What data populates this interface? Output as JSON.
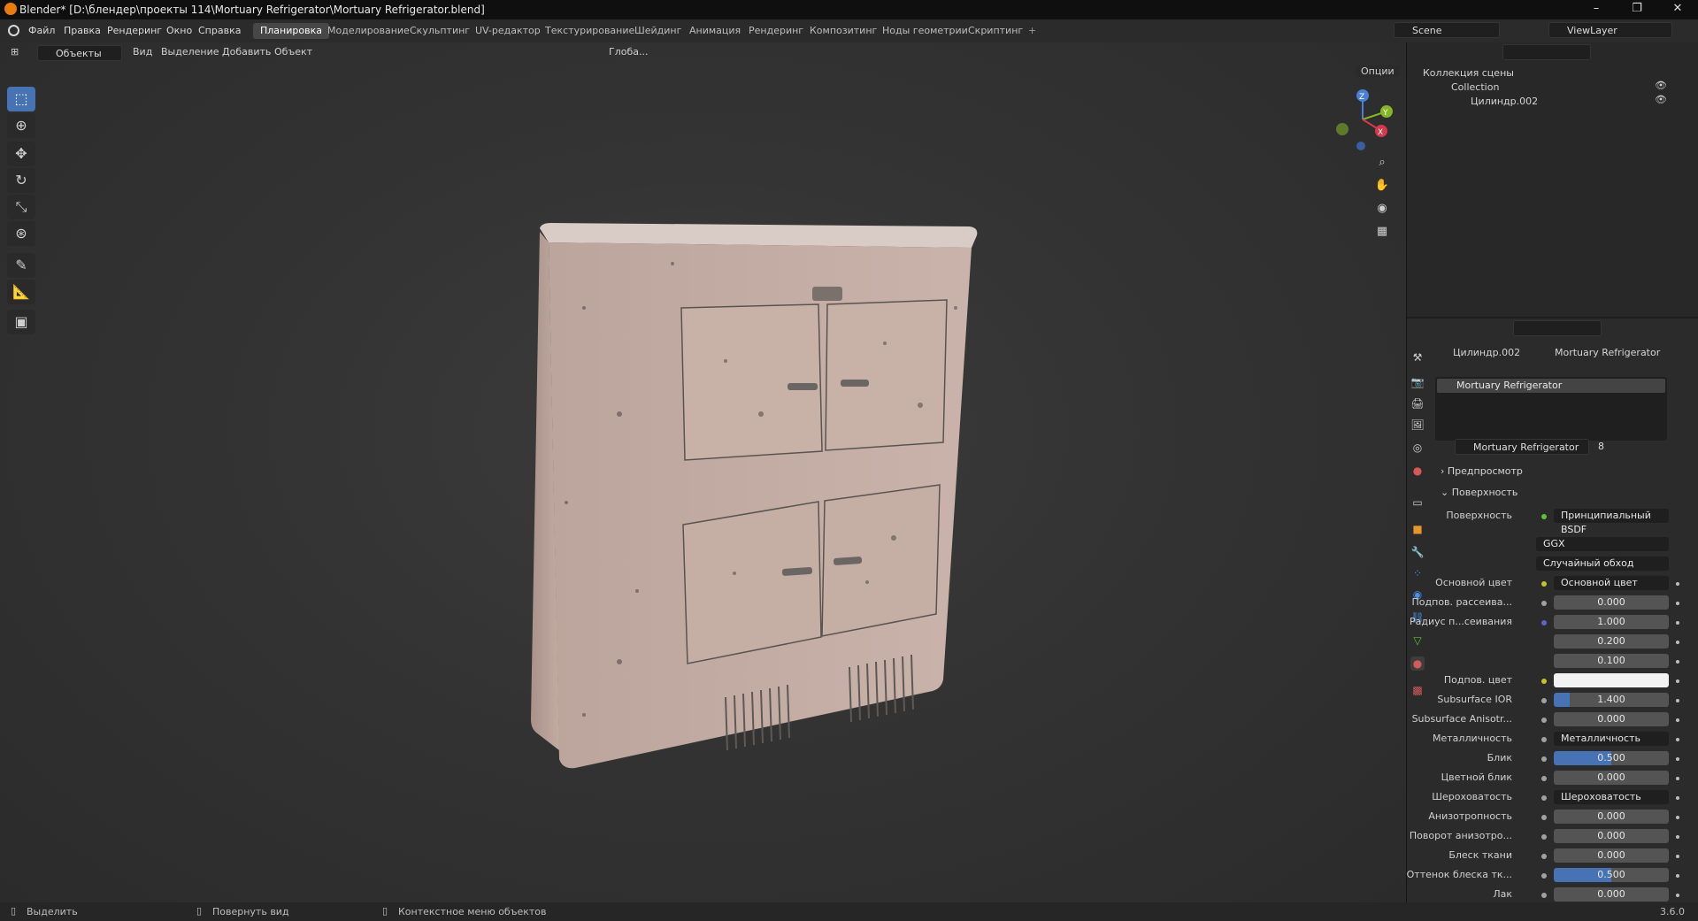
{
  "titlebar": {
    "title": "Blender* [D:\\блендер\\проекты 114\\Mortuary Refrigerator\\Mortuary Refrigerator.blend]",
    "min": "–",
    "max": "❐",
    "close": "✕"
  },
  "menu": {
    "items": [
      "Файл",
      "Правка",
      "Рендеринг",
      "Окно",
      "Справка"
    ]
  },
  "workspaces": [
    "Планировка",
    "Моделирование",
    "Скульптинг",
    "UV-редактор",
    "Текстурирование",
    "Шейдинг",
    "Анимация",
    "Рендеринг",
    "Композитинг",
    "Ноды геометрии",
    "Скриптинг",
    "+"
  ],
  "scene": {
    "scene_name": "Scene",
    "view_layer": "ViewLayer"
  },
  "viewport": {
    "mode": "Объекты",
    "menus": [
      "Вид",
      "Выделение",
      "Добавить",
      "Объект"
    ],
    "orientation": "Глоба...",
    "options": "Опции",
    "gizmo": {
      "x": "X",
      "y": "Y",
      "z": "Z"
    }
  },
  "outliner": {
    "root": "Коллекция сцены",
    "collection": "Collection",
    "object": "Цилиндр.002"
  },
  "properties": {
    "breadcrumb_object": "Цилиндр.002",
    "breadcrumb_material": "Mortuary Refrigerator",
    "slot_name": "Mortuary Refrigerator",
    "material_name": "Mortuary Refrigerator",
    "users": "8",
    "section_preview": "Предпросмотр",
    "section_surface": "Поверхность",
    "surface_label": "Поверхность",
    "surface_value": "Принципиальный BSDF",
    "distribution": "GGX",
    "subsurface_method": "Случайный обход",
    "rows": [
      {
        "label": "Основной цвет",
        "value": "Основной цвет",
        "kind": "link",
        "dot": "#c7c229"
      },
      {
        "label": "Подпов. рассеива...",
        "value": "0.000",
        "kind": "num",
        "dot": "#a1a1a1"
      },
      {
        "label": "Радиус п...сеивания",
        "value": "1.000",
        "kind": "num",
        "dot": "#6363c7"
      },
      {
        "label": "",
        "value": "0.200",
        "kind": "num",
        "dot": ""
      },
      {
        "label": "",
        "value": "0.100",
        "kind": "num",
        "dot": ""
      },
      {
        "label": "Подпов. цвет",
        "value": "",
        "kind": "color",
        "dot": "#c7c229"
      },
      {
        "label": "Subsurface IOR",
        "value": "1.400",
        "kind": "blue",
        "fill": 0.14,
        "dot": "#a1a1a1"
      },
      {
        "label": "Subsurface Anisotr...",
        "value": "0.000",
        "kind": "num",
        "dot": "#a1a1a1"
      },
      {
        "label": "Металличность",
        "value": "Металличность",
        "kind": "link",
        "dot": "#a1a1a1"
      },
      {
        "label": "Блик",
        "value": "0.500",
        "kind": "blue",
        "fill": 0.5,
        "dot": "#a1a1a1"
      },
      {
        "label": "Цветной блик",
        "value": "0.000",
        "kind": "num",
        "dot": "#a1a1a1"
      },
      {
        "label": "Шероховатость",
        "value": "Шероховатость",
        "kind": "link",
        "dot": "#a1a1a1"
      },
      {
        "label": "Анизотропность",
        "value": "0.000",
        "kind": "num",
        "dot": "#a1a1a1"
      },
      {
        "label": "Поворот анизотро...",
        "value": "0.000",
        "kind": "num",
        "dot": "#a1a1a1"
      },
      {
        "label": "Блеск ткани",
        "value": "0.000",
        "kind": "num",
        "dot": "#a1a1a1"
      },
      {
        "label": "Оттенок блеска тк...",
        "value": "0.500",
        "kind": "blue",
        "fill": 0.5,
        "dot": "#a1a1a1"
      },
      {
        "label": "Лак",
        "value": "0.000",
        "kind": "num",
        "dot": "#a1a1a1"
      }
    ]
  },
  "statusbar": {
    "select": "Выделить",
    "rotate": "Повернуть вид",
    "context": "Контекстное меню объектов",
    "version": "3.6.0"
  }
}
